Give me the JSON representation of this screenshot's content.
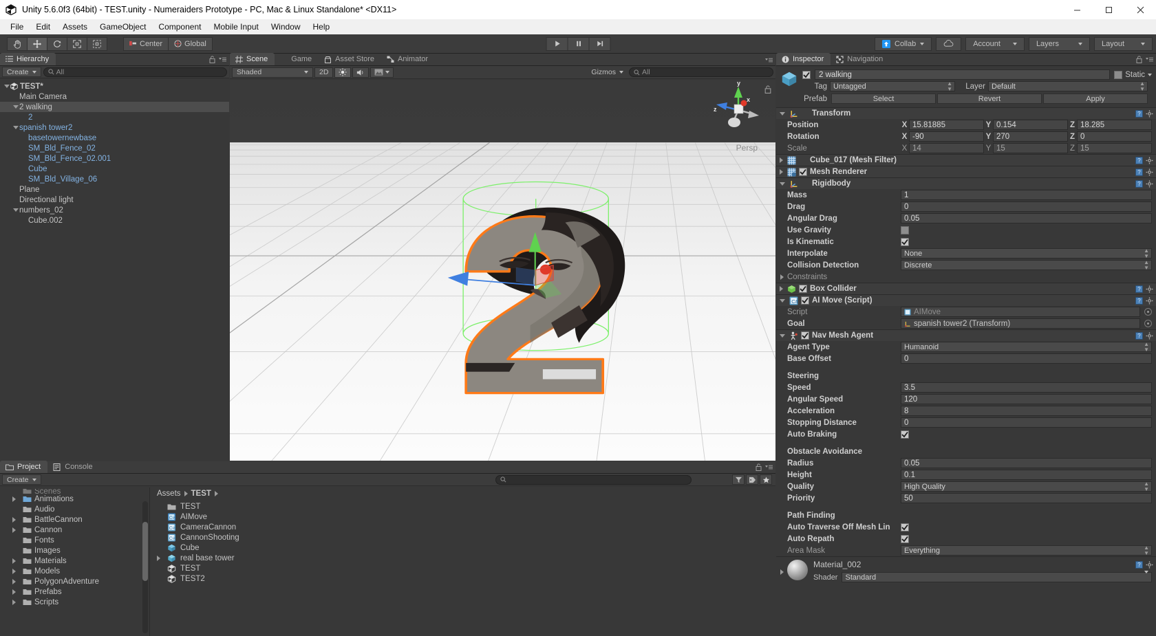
{
  "window": {
    "title": "Unity 5.6.0f3 (64bit) - TEST.unity - Numeraiders Prototype - PC, Mac & Linux Standalone* <DX11>",
    "minimize": "minimize-icon",
    "maximize": "maximize-icon",
    "close": "close-icon"
  },
  "menu": {
    "items": [
      "File",
      "Edit",
      "Assets",
      "GameObject",
      "Component",
      "Mobile Input",
      "Window",
      "Help"
    ]
  },
  "toolbar": {
    "tools": [
      {
        "name": "hand-tool",
        "icon": "hand-icon",
        "active": false
      },
      {
        "name": "move-tool",
        "icon": "move-icon",
        "active": true
      },
      {
        "name": "rotate-tool",
        "icon": "rotate-icon",
        "active": false
      },
      {
        "name": "scale-tool",
        "icon": "scale-icon",
        "active": false
      },
      {
        "name": "rect-tool",
        "icon": "rect-icon",
        "active": false
      }
    ],
    "pivot_mode": "Center",
    "pivot_rotation": "Global",
    "play": "play-icon",
    "pause": "pause-icon",
    "step": "step-icon",
    "collab": "Collab",
    "cloud": "cloud-icon",
    "account": "Account",
    "layers": "Layers",
    "layout": "Layout"
  },
  "hierarchy": {
    "tab": "Hierarchy",
    "create": "Create",
    "search_placeholder": "All",
    "items": [
      {
        "label": "TEST*",
        "indent": 0,
        "arrow": "down",
        "unity_icon": true,
        "bold": true,
        "blue": false,
        "selected": false
      },
      {
        "label": "Main Camera",
        "indent": 1,
        "arrow": "",
        "blue": false,
        "selected": false
      },
      {
        "label": "2 walking",
        "indent": 1,
        "arrow": "down",
        "blue": false,
        "selected": true
      },
      {
        "label": "2",
        "indent": 2,
        "arrow": "",
        "blue": true,
        "selected": false
      },
      {
        "label": "spanish tower2",
        "indent": 1,
        "arrow": "down",
        "blue": true,
        "selected": false
      },
      {
        "label": "basetowernewbase",
        "indent": 2,
        "arrow": "",
        "blue": true,
        "selected": false
      },
      {
        "label": "SM_Bld_Fence_02",
        "indent": 2,
        "arrow": "",
        "blue": true,
        "selected": false
      },
      {
        "label": "SM_Bld_Fence_02.001",
        "indent": 2,
        "arrow": "",
        "blue": true,
        "selected": false
      },
      {
        "label": "Cube",
        "indent": 2,
        "arrow": "",
        "blue": true,
        "selected": false
      },
      {
        "label": "SM_Bld_Village_06",
        "indent": 2,
        "arrow": "",
        "blue": true,
        "selected": false
      },
      {
        "label": "Plane",
        "indent": 1,
        "arrow": "",
        "blue": false,
        "selected": false
      },
      {
        "label": "Directional light",
        "indent": 1,
        "arrow": "",
        "blue": false,
        "selected": false
      },
      {
        "label": "numbers_02",
        "indent": 1,
        "arrow": "down",
        "blue": false,
        "selected": false
      },
      {
        "label": "Cube.002",
        "indent": 2,
        "arrow": "",
        "blue": false,
        "selected": false
      }
    ]
  },
  "scene": {
    "tabs": [
      {
        "label": "Scene",
        "icon": "grid-icon",
        "active": true
      },
      {
        "label": "Game",
        "icon": "gamepad-icon",
        "active": false
      },
      {
        "label": "Asset Store",
        "icon": "store-icon",
        "active": false
      },
      {
        "label": "Animator",
        "icon": "animator-icon",
        "active": false
      }
    ],
    "draw_mode": "Shaded",
    "two_d": "2D",
    "lighting": "light-icon",
    "audio": "audio-icon",
    "fx": "fx-icon",
    "gizmos": "Gizmos",
    "search_placeholder": "All",
    "perspective_label": "Persp",
    "axis_gizmo": {
      "x": "x",
      "y": "y",
      "z": "z"
    }
  },
  "inspector": {
    "tabs": [
      {
        "label": "Inspector",
        "icon": "info-icon",
        "active": true
      },
      {
        "label": "Navigation",
        "icon": "navigation-icon",
        "active": false
      }
    ],
    "object_name": "2 walking",
    "object_enabled": true,
    "static_label": "Static",
    "static_checked": false,
    "tag_label": "Tag",
    "tag_value": "Untagged",
    "layer_label": "Layer",
    "layer_value": "Default",
    "prefab_label": "Prefab",
    "prefab_buttons": [
      "Select",
      "Revert",
      "Apply"
    ],
    "components": [
      {
        "name": "Transform",
        "icon": "transform-icon",
        "expanded": true,
        "has_checkbox": false,
        "rows": [
          {
            "label": "Position",
            "type": "vector3",
            "x": "15.81885",
            "y": "0.154",
            "z": "18.285",
            "dim": false
          },
          {
            "label": "Rotation",
            "type": "vector3",
            "x": "-90",
            "y": "270",
            "z": "0",
            "dim": false
          },
          {
            "label": "Scale",
            "type": "vector3",
            "x": "14",
            "y": "15",
            "z": "15",
            "dim": true
          }
        ]
      },
      {
        "name": "Cube_017 (Mesh Filter)",
        "icon": "meshfilter-icon",
        "expanded": false,
        "has_checkbox": false,
        "rows": []
      },
      {
        "name": "Mesh Renderer",
        "icon": "meshrenderer-icon",
        "expanded": false,
        "has_checkbox": true,
        "checked": true,
        "rows": []
      },
      {
        "name": "Rigidbody",
        "icon": "rigidbody-icon",
        "expanded": true,
        "has_checkbox": false,
        "rows": [
          {
            "label": "Mass",
            "type": "text",
            "value": "1"
          },
          {
            "label": "Drag",
            "type": "text",
            "value": "0"
          },
          {
            "label": "Angular Drag",
            "type": "text",
            "value": "0.05"
          },
          {
            "label": "Use Gravity",
            "type": "checkbox",
            "checked": false
          },
          {
            "label": "Is Kinematic",
            "type": "checkbox",
            "checked": true
          },
          {
            "label": "Interpolate",
            "type": "dropdown",
            "value": "None"
          },
          {
            "label": "Collision Detection",
            "type": "dropdown",
            "value": "Discrete"
          },
          {
            "label": "Constraints",
            "type": "foldout",
            "dim": true
          }
        ]
      },
      {
        "name": "Box Collider",
        "icon": "boxcollider-icon",
        "expanded": false,
        "has_checkbox": true,
        "checked": true,
        "rows": []
      },
      {
        "name": "AI Move (Script)",
        "icon": "script-icon",
        "expanded": true,
        "has_checkbox": true,
        "checked": true,
        "rows": [
          {
            "label": "Script",
            "type": "object",
            "value": "AIMove",
            "icon": "script-small-icon",
            "dim": true
          },
          {
            "label": "Goal",
            "type": "object",
            "value": "spanish tower2 (Transform)",
            "icon": "transform-small-icon",
            "dim": false
          }
        ]
      },
      {
        "name": "Nav Mesh Agent",
        "icon": "navmeshagent-icon",
        "expanded": true,
        "has_checkbox": true,
        "checked": true,
        "rows": [
          {
            "label": "Agent Type",
            "type": "dropdown",
            "value": "Humanoid"
          },
          {
            "label": "Base Offset",
            "type": "text",
            "value": "0"
          },
          {
            "label": "",
            "type": "spacer"
          },
          {
            "label": "Steering",
            "type": "header"
          },
          {
            "label": "Speed",
            "type": "text",
            "value": "3.5"
          },
          {
            "label": "Angular Speed",
            "type": "text",
            "value": "120"
          },
          {
            "label": "Acceleration",
            "type": "text",
            "value": "8"
          },
          {
            "label": "Stopping Distance",
            "type": "text",
            "value": "0"
          },
          {
            "label": "Auto Braking",
            "type": "checkbox",
            "checked": true
          },
          {
            "label": "",
            "type": "spacer"
          },
          {
            "label": "Obstacle Avoidance",
            "type": "header"
          },
          {
            "label": "Radius",
            "type": "text",
            "value": "0.05"
          },
          {
            "label": "Height",
            "type": "text",
            "value": "0.1"
          },
          {
            "label": "Quality",
            "type": "dropdown",
            "value": "High Quality"
          },
          {
            "label": "Priority",
            "type": "text",
            "value": "50"
          },
          {
            "label": "",
            "type": "spacer"
          },
          {
            "label": "Path Finding",
            "type": "header"
          },
          {
            "label": "Auto Traverse Off Mesh Lin",
            "type": "checkbox",
            "checked": true
          },
          {
            "label": "Auto Repath",
            "type": "checkbox",
            "checked": true
          },
          {
            "label": "Area Mask",
            "type": "dropdown",
            "value": "Everything",
            "dim": true
          }
        ]
      }
    ],
    "material": {
      "name": "Material_002",
      "shader_label": "Shader",
      "shader_value": "Standard"
    }
  },
  "project": {
    "tabs": [
      {
        "label": "Project",
        "icon": "folder-icon",
        "active": true
      },
      {
        "label": "Console",
        "icon": "console-icon",
        "active": false
      }
    ],
    "create": "Create",
    "folders": [
      {
        "label": "Scenes",
        "arrow": "",
        "cut": true
      },
      {
        "label": "Animations",
        "arrow": "right",
        "special": true
      },
      {
        "label": "Audio",
        "arrow": ""
      },
      {
        "label": "BattleCannon",
        "arrow": "right"
      },
      {
        "label": "Cannon",
        "arrow": "right"
      },
      {
        "label": "Fonts",
        "arrow": ""
      },
      {
        "label": "Images",
        "arrow": ""
      },
      {
        "label": "Materials",
        "arrow": "right"
      },
      {
        "label": "Models",
        "arrow": "right"
      },
      {
        "label": "PolygonAdventure",
        "arrow": "right"
      },
      {
        "label": "Prefabs",
        "arrow": "right"
      },
      {
        "label": "Scripts",
        "arrow": "right"
      }
    ],
    "breadcrumb": [
      "Assets",
      "TEST"
    ],
    "assets": [
      {
        "label": "TEST",
        "icon": "folder-icon",
        "arrow": ""
      },
      {
        "label": "AIMove",
        "icon": "cs-script-selected-icon",
        "arrow": ""
      },
      {
        "label": "CameraCannon",
        "icon": "cs-script-icon",
        "arrow": ""
      },
      {
        "label": "CannonShooting",
        "icon": "cs-script-icon",
        "arrow": ""
      },
      {
        "label": "Cube",
        "icon": "prefab-icon",
        "arrow": ""
      },
      {
        "label": "real base tower",
        "icon": "model-icon",
        "arrow": "right"
      },
      {
        "label": "TEST",
        "icon": "unity-scene-icon",
        "arrow": ""
      },
      {
        "label": "TEST2",
        "icon": "unity-scene-icon",
        "arrow": ""
      }
    ],
    "toolbar_icons": [
      "filter-by-type-icon",
      "filter-by-label-icon",
      "favorites-icon"
    ]
  },
  "colors": {
    "selection_outline": "#ff7a18",
    "navmesh_gizmo": "#7cf06a",
    "x_axis": "#e04a4a",
    "y_axis": "#5fd24f",
    "z_axis": "#3f7fe0",
    "panel_bg": "#383838",
    "toolbar_bg": "#3c3c3c"
  }
}
